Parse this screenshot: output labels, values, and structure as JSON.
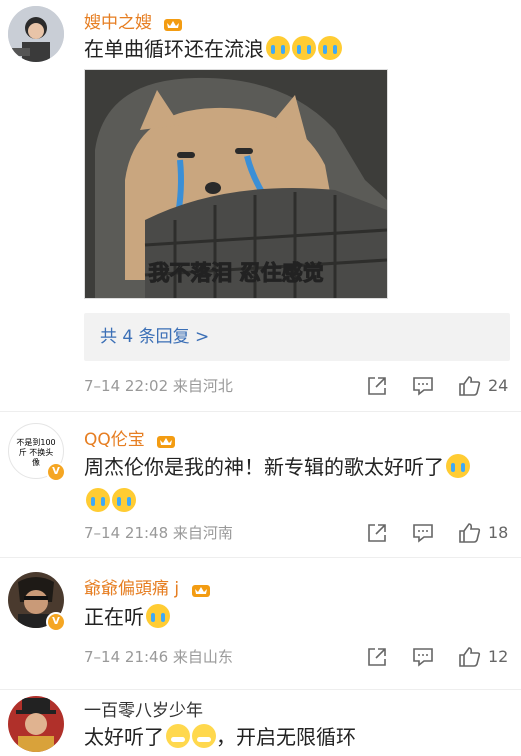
{
  "comments": [
    {
      "username": "嫂中之嫂",
      "text": "在单曲循环还在流浪",
      "image_caption": "我不落泪 忍住感觉",
      "replies_label": "共 4 条回复 >",
      "time": "7–14 22:02",
      "location": "来自河北",
      "likes": "24"
    },
    {
      "username": "QQ伦宝",
      "avatar_text": "不是到100斤 不换头像",
      "verified": "V",
      "text": "周杰伦你是我的神！新专辑的歌太好听了",
      "time": "7–14 21:48",
      "location": "来自河南",
      "likes": "18"
    },
    {
      "username": "爺爺偏頭痛 j",
      "verified": "V",
      "text": "正在听",
      "time": "7–14 21:46",
      "location": "来自山东",
      "likes": "12"
    },
    {
      "username": "一百零八岁少年",
      "text_a": "太好听了",
      "text_b": "，开启无限循环"
    }
  ],
  "colors": {
    "username": "#e67e22",
    "link": "#3b6fb6",
    "meta": "#999999"
  },
  "icons": [
    "crown-badge-icon",
    "share-icon",
    "comment-icon",
    "like-icon",
    "crying-emoji-icon",
    "grin-emoji-icon"
  ]
}
